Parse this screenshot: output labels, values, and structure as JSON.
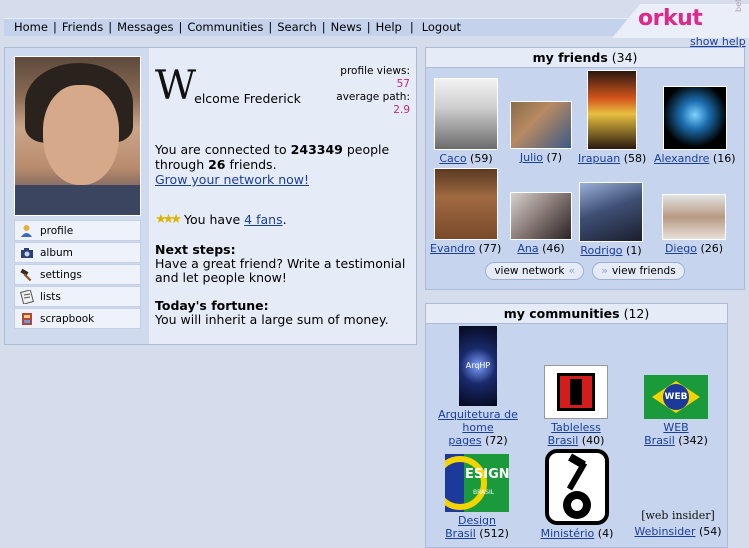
{
  "nav": {
    "items": [
      "Home",
      "Friends",
      "Messages",
      "Communities",
      "Search",
      "News",
      "Help",
      "Logout"
    ],
    "logo": "orkut",
    "beta": "beta",
    "show_help": "show help"
  },
  "profile": {
    "welcome_initial": "W",
    "welcome_rest": "elcome Frederick",
    "profile_views_label": "profile views:",
    "profile_views": "57",
    "average_path_label": "average path:",
    "average_path": "2.9",
    "menu": [
      {
        "label": "profile",
        "icon": "person-icon"
      },
      {
        "label": "album",
        "icon": "camera-icon"
      },
      {
        "label": "settings",
        "icon": "hammer-icon"
      },
      {
        "label": "lists",
        "icon": "list-icon"
      },
      {
        "label": "scrapbook",
        "icon": "scrapbook-icon"
      }
    ],
    "connected_pre": "You are connected to",
    "connected_people": "243349",
    "connected_mid1": "people",
    "connected_mid2": "through",
    "connected_friends": "26",
    "connected_post": "friends.",
    "grow_link": "Grow your network now!",
    "fans_pre": "You have",
    "fans_link": "4 fans",
    "fans_post": ".",
    "next_steps_title": "Next steps:",
    "next_steps_text": "Have a great friend? Write a testimonial and let people know!",
    "fortune_title": "Today's fortune:",
    "fortune_text": "You will inherit a large sum of money."
  },
  "friends": {
    "title": "my friends",
    "count": "(34)",
    "list": [
      {
        "name": "Caco",
        "count": "(59)"
      },
      {
        "name": "Julio",
        "count": "(7)"
      },
      {
        "name": "Irapuan",
        "count": "(58)"
      },
      {
        "name": "Alexandre",
        "count": "(16)"
      },
      {
        "name": "Evandro",
        "count": "(77)"
      },
      {
        "name": "Ana",
        "count": "(46)"
      },
      {
        "name": "Rodrigo",
        "count": "(1)"
      },
      {
        "name": "Diego",
        "count": "(26)"
      }
    ],
    "view_network": "view network",
    "view_friends": "view friends"
  },
  "communities": {
    "title": "my communities",
    "count": "(12)",
    "list": [
      {
        "name_line1": "Arquitetura de",
        "name_line2": "home",
        "name_line3": "pages",
        "count": "(72)",
        "logo_text": "ArqHP"
      },
      {
        "name_line1": "Tableless",
        "name_line2": "Brasil",
        "count": "(40)"
      },
      {
        "name_line1": "WEB",
        "name_line2": "Brasil",
        "count": "(342)",
        "logo_text": "WEB"
      },
      {
        "name_line1": "Design",
        "name_line2": "Brasil",
        "count": "(512)",
        "logo_text": "ESIGN",
        "logo_text2": "BRASIL"
      },
      {
        "name_line1": "Ministério",
        "count": "(4)"
      },
      {
        "name_line1": "Webinsider",
        "count": "(54)",
        "logo_text": "[web insider]"
      }
    ]
  }
}
